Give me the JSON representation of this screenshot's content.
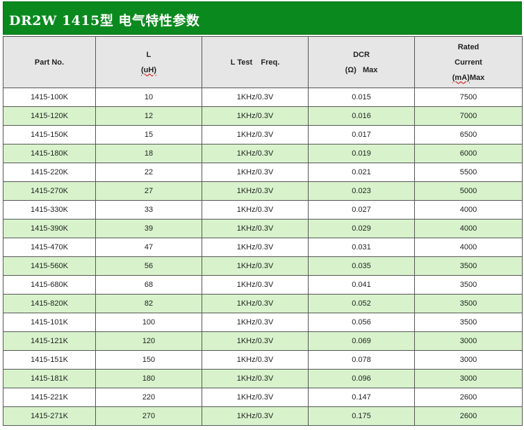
{
  "title": "DR2W 1415型 电气特性参数",
  "header": {
    "part_no": "Part No.",
    "l_line1": "L",
    "l_line2": "(uH)",
    "test_freq": "L Test    Freq.",
    "dcr_line1": "DCR",
    "dcr_line2": "(Ω)   Max",
    "current_line1": "Rated",
    "current_line2": "Current",
    "current_line3_ul": "(mA)",
    "current_line3_rest": "Max"
  },
  "rows": [
    {
      "part": "1415-100K",
      "l": "10",
      "freq": "1KHz/0.3V",
      "dcr": "0.015",
      "current": "7500"
    },
    {
      "part": "1415-120K",
      "l": "12",
      "freq": "1KHz/0.3V",
      "dcr": "0.016",
      "current": "7000"
    },
    {
      "part": "1415-150K",
      "l": "15",
      "freq": "1KHz/0.3V",
      "dcr": "0.017",
      "current": "6500"
    },
    {
      "part": "1415-180K",
      "l": "18",
      "freq": "1KHz/0.3V",
      "dcr": "0.019",
      "current": "6000"
    },
    {
      "part": "1415-220K",
      "l": "22",
      "freq": "1KHz/0.3V",
      "dcr": "0.021",
      "current": "5500"
    },
    {
      "part": "1415-270K",
      "l": "27",
      "freq": "1KHz/0.3V",
      "dcr": "0.023",
      "current": "5000"
    },
    {
      "part": "1415-330K",
      "l": "33",
      "freq": "1KHz/0.3V",
      "dcr": "0.027",
      "current": "4000"
    },
    {
      "part": "1415-390K",
      "l": "39",
      "freq": "1KHz/0.3V",
      "dcr": "0.029",
      "current": "4000"
    },
    {
      "part": "1415-470K",
      "l": "47",
      "freq": "1KHz/0.3V",
      "dcr": "0.031",
      "current": "4000"
    },
    {
      "part": "1415-560K",
      "l": "56",
      "freq": "1KHz/0.3V",
      "dcr": "0.035",
      "current": "3500"
    },
    {
      "part": "1415-680K",
      "l": "68",
      "freq": "1KHz/0.3V",
      "dcr": "0.041",
      "current": "3500"
    },
    {
      "part": "1415-820K",
      "l": "82",
      "freq": "1KHz/0.3V",
      "dcr": "0.052",
      "current": "3500"
    },
    {
      "part": "1415-101K",
      "l": "100",
      "freq": "1KHz/0.3V",
      "dcr": "0.056",
      "current": "3500"
    },
    {
      "part": "1415-121K",
      "l": "120",
      "freq": "1KHz/0.3V",
      "dcr": "0.069",
      "current": "3000"
    },
    {
      "part": "1415-151K",
      "l": "150",
      "freq": "1KHz/0.3V",
      "dcr": "0.078",
      "current": "3000"
    },
    {
      "part": "1415-181K",
      "l": "180",
      "freq": "1KHz/0.3V",
      "dcr": "0.096",
      "current": "3000"
    },
    {
      "part": "1415-221K",
      "l": "220",
      "freq": "1KHz/0.3V",
      "dcr": "0.147",
      "current": "2600"
    },
    {
      "part": "1415-271K",
      "l": "270",
      "freq": "1KHz/0.3V",
      "dcr": "0.175",
      "current": "2600"
    }
  ],
  "colors": {
    "title_bg": "#0a8a1e",
    "row_alt": "#d8f3cc",
    "header_bg": "#e6e6e6"
  }
}
